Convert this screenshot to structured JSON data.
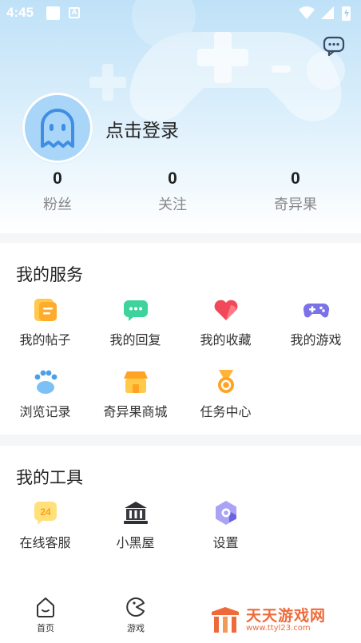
{
  "status_bar": {
    "time": "4:45",
    "a_badge": "A"
  },
  "profile": {
    "login_text": "点击登录"
  },
  "stats": [
    {
      "value": "0",
      "label": "粉丝"
    },
    {
      "value": "0",
      "label": "关注"
    },
    {
      "value": "0",
      "label": "奇异果"
    }
  ],
  "services": {
    "title": "我的服务",
    "items": [
      {
        "label": "我的帖子",
        "icon": "post-icon"
      },
      {
        "label": "我的回复",
        "icon": "reply-icon"
      },
      {
        "label": "我的收藏",
        "icon": "favorite-heart-icon"
      },
      {
        "label": "我的游戏",
        "icon": "gamepad-icon"
      },
      {
        "label": "浏览记录",
        "icon": "paw-history-icon"
      },
      {
        "label": "奇异果商城",
        "icon": "store-icon"
      },
      {
        "label": "任务中心",
        "icon": "medal-icon"
      }
    ]
  },
  "tools": {
    "title": "我的工具",
    "items": [
      {
        "label": "在线客服",
        "icon": "customer-service-24-icon",
        "icon_text": "24"
      },
      {
        "label": "小黑屋",
        "icon": "jail-house-icon"
      },
      {
        "label": "设置",
        "icon": "settings-hexagon-icon"
      }
    ]
  },
  "bottom_nav": {
    "tabs": [
      {
        "label": "首页",
        "icon": "home-icon"
      },
      {
        "label": "游戏",
        "icon": "game-pacman-icon"
      }
    ]
  },
  "watermark": {
    "name": "天天游戏网",
    "url": "www.ttyl23.com"
  },
  "colors": {
    "accent_blue": "#4a90e2",
    "page_bg": "#f5f6f7",
    "watermark": "#ef6a3a"
  }
}
